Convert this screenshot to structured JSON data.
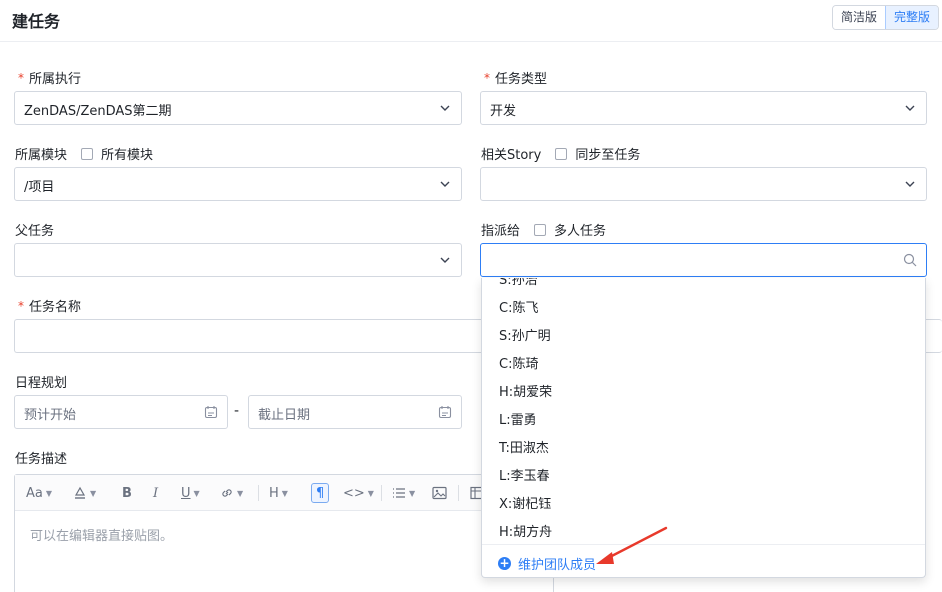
{
  "header": {
    "title": "建任务",
    "modes": [
      "简洁版",
      "完整版"
    ],
    "active_mode": "完整版"
  },
  "form": {
    "execution": {
      "label": "所属执行",
      "required": true,
      "value": "ZenDAS/ZenDAS第二期"
    },
    "task_type": {
      "label": "任务类型",
      "required": true,
      "value": "开发"
    },
    "module": {
      "label": "所属模块",
      "checkbox_label": "所有模块",
      "value": "/项目"
    },
    "story": {
      "label": "相关Story",
      "checkbox_label": "同步至任务",
      "value": ""
    },
    "parent": {
      "label": "父任务",
      "value": ""
    },
    "assign": {
      "label": "指派给",
      "checkbox_label": "多人任务",
      "value": ""
    },
    "name": {
      "label": "任务名称",
      "required": true,
      "value": ""
    },
    "schedule": {
      "label": "日程规划",
      "start_placeholder": "预计开始",
      "end_placeholder": "截止日期",
      "separator": "-"
    },
    "description": {
      "label": "任务描述",
      "placeholder": "可以在编辑器直接贴图。"
    }
  },
  "editor_toolbar": {
    "font_size": "Aa",
    "bold": "B",
    "italic": "I",
    "underline": "U",
    "heading": "H",
    "paragraph": "¶",
    "code": "<>"
  },
  "assign_dropdown": {
    "partial_top": "S:孙治",
    "options": [
      "C:陈飞",
      "S:孙广明",
      "C:陈琦",
      "H:胡爱荣",
      "L:雷勇",
      "T:田淑杰",
      "L:李玉春",
      "X:谢杞钰",
      "H:胡方舟"
    ],
    "footer_action": "维护团队成员"
  },
  "colors": {
    "accent": "#2e7ef5",
    "required": "#e8402c",
    "annotation_arrow": "#e8392b"
  }
}
